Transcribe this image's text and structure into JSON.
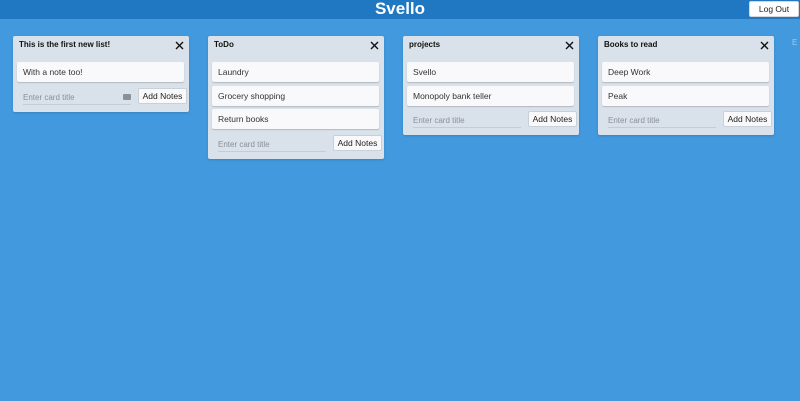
{
  "header": {
    "title": "Svello",
    "logout_label": "Log Out"
  },
  "lists": [
    {
      "title": "This is the first new list!",
      "cards": [
        "With a note too!"
      ],
      "input_placeholder": "Enter card title",
      "add_label": "Add Notes"
    },
    {
      "title": "ToDo",
      "cards": [
        "Laundry",
        "Grocery shopping",
        "Return books"
      ],
      "input_placeholder": "Enter card title",
      "add_label": "Add Notes"
    },
    {
      "title": "projects",
      "cards": [
        "Svello",
        "Monopoly bank teller"
      ],
      "input_placeholder": "Enter card title",
      "add_label": "Add Notes"
    },
    {
      "title": "Books to read",
      "cards": [
        "Deep Work",
        "Peak"
      ],
      "input_placeholder": "Enter card title",
      "add_label": "Add Notes"
    }
  ],
  "new_list_stub": "E",
  "colors": {
    "background": "#4299dd",
    "header": "#1f78c1",
    "list": "#d9e1ea",
    "card": "#f9f9fb"
  }
}
